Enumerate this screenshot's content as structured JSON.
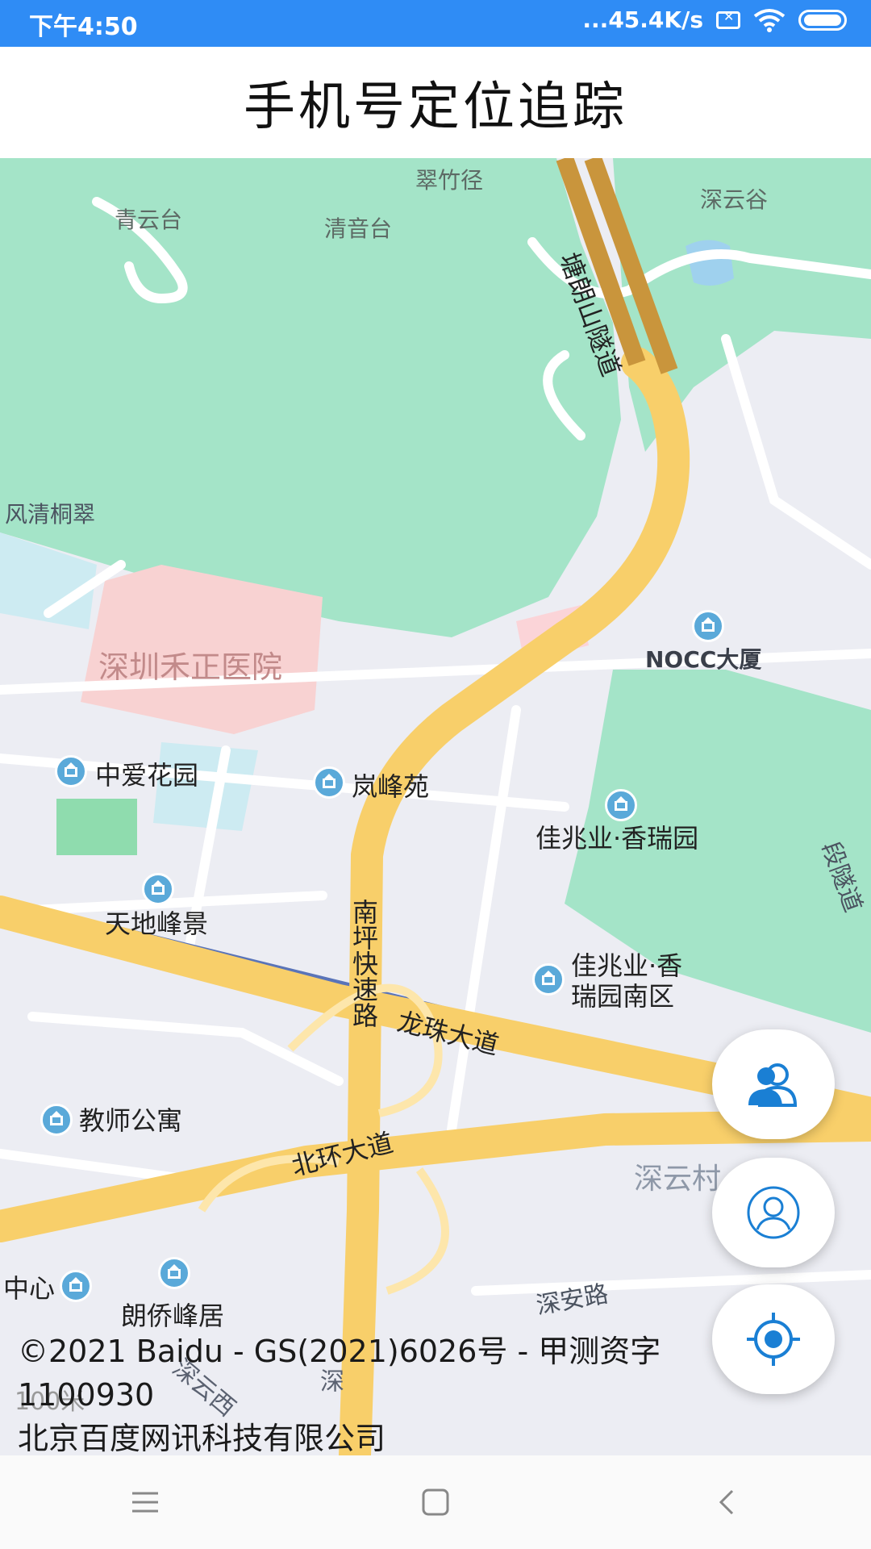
{
  "status_bar": {
    "time": "下午4:50",
    "network_speed": "...45.4K/s",
    "icons": [
      "sim-error-icon",
      "wifi-icon",
      "battery-icon"
    ]
  },
  "header": {
    "title": "手机号定位追踪"
  },
  "map": {
    "labels": {
      "cuizhujing": "翠竹径",
      "shenyungu": "深云谷",
      "qingyuntai": "青云台",
      "qingyintai": "清音台",
      "tanglangshan_tunnel": "塘朗山隧道",
      "fengqingtongcui": "风清桐翠",
      "hezheng_hospital": "深圳禾正医院",
      "nocc": "NOCC大厦",
      "zhongai_garden": "中爱花园",
      "lanfengyuan": "岚峰苑",
      "jiazhaoye_xiangruiyuan": "佳兆业·香瑞园",
      "tiandi_fengjing": "天地峰景",
      "jiazhaoye_south_1": "佳兆业·香",
      "jiazhaoye_south_2": "瑞园南区",
      "duan_tunnel": "段隧道",
      "nanping_expressway": "南坪快速路",
      "longzhu_avenue": "龙珠大道",
      "jiaoshi_apartment": "教师公寓",
      "beihuan_avenue": "北环大道",
      "shenyuncun": "深云村",
      "zhongxin": "中心",
      "langqiao_fengju": "朗侨峰居",
      "shenan_road": "深安路",
      "shenyun_west": "深云西",
      "shen_road": "深"
    },
    "scale": "100米",
    "copyright_line1": "©2021 Baidu - GS(2021)6026号 - 甲测资字",
    "copyright_line2": "1100930",
    "copyright_line3": "北京百度网讯科技有限公司"
  },
  "buttons": {
    "contacts": "contacts-icon",
    "profile": "user-profile-icon",
    "locate": "locate-target-icon"
  },
  "nav_bar": {
    "icons": [
      "menu-icon",
      "home-square-icon",
      "back-chevron-icon"
    ]
  },
  "colors": {
    "status_bar": "#2f8cf5",
    "accent_blue": "#1a7fd4",
    "map_green": "#a4e4c8",
    "road_yellow": "#f8cf6a",
    "tunnel_brown": "#c9953c"
  }
}
